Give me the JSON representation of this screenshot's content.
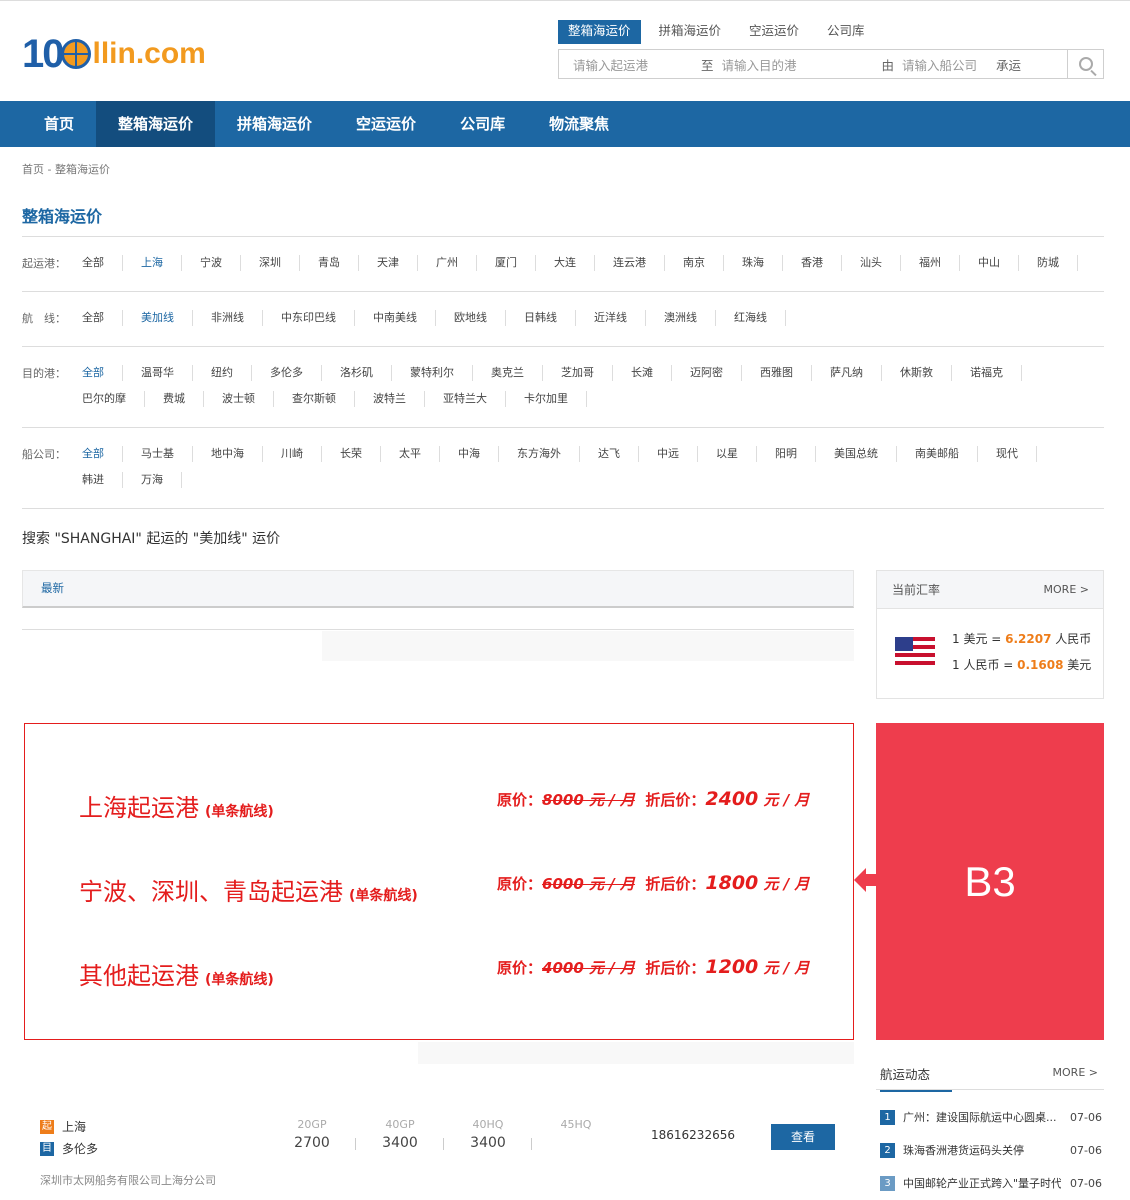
{
  "logo": {
    "num": "10",
    "rest": "llin.com"
  },
  "search": {
    "tabs": [
      "整箱海运价",
      "拼箱海运价",
      "空运运价",
      "公司库"
    ],
    "from_placeholder": "请输入起运港",
    "sep_to": "至",
    "to_placeholder": "请输入目的港",
    "sep_by": "由",
    "carrier_placeholder": "请输入船公司",
    "ship": "承运"
  },
  "nav": [
    "首页",
    "整箱海运价",
    "拼箱海运价",
    "空运运价",
    "公司库",
    "物流聚焦"
  ],
  "breadcrumb": "首页  -  整箱海运价",
  "page_title": "整箱海运价",
  "filters": {
    "origin": {
      "label": "起运港：",
      "options": [
        "全部",
        "上海",
        "宁波",
        "深圳",
        "青岛",
        "天津",
        "广州",
        "厦门",
        "大连",
        "连云港",
        "南京",
        "珠海",
        "香港",
        "汕头",
        "福州",
        "中山",
        "防城"
      ],
      "active": 1
    },
    "route": {
      "label": "航　线：",
      "options": [
        "全部",
        "美加线",
        "非洲线",
        "中东印巴线",
        "中南美线",
        "欧地线",
        "日韩线",
        "近洋线",
        "澳洲线",
        "红海线"
      ],
      "active": 1
    },
    "destination": {
      "label": "目的港：",
      "options": [
        "全部",
        "温哥华",
        "纽约",
        "多伦多",
        "洛杉矶",
        "蒙特利尔",
        "奥克兰",
        "芝加哥",
        "长滩",
        "迈阿密",
        "西雅图",
        "萨凡纳",
        "休斯敦",
        "诺福克",
        "巴尔的摩",
        "费城",
        "波士顿",
        "查尔斯顿",
        "波特兰",
        "亚特兰大",
        "卡尔加里"
      ],
      "active": 0
    },
    "carrier": {
      "label": "船公司：",
      "options": [
        "全部",
        "马士基",
        "地中海",
        "川崎",
        "长荣",
        "太平",
        "中海",
        "东方海外",
        "达飞",
        "中远",
        "以星",
        "阳明",
        "美国总统",
        "南美邮船",
        "现代",
        "韩进",
        "万海"
      ],
      "active": 0
    }
  },
  "search_result": "搜索 \"SHANGHAI\" 起运的 \"美加线\" 运价",
  "list_tab": "最新",
  "rate": {
    "title": "当前汇率",
    "more": "MORE >",
    "line1_pre": "1 美元 = ",
    "line1_val": "6.2207",
    "line1_post": " 人民币",
    "line2_pre": "1 人民币 = ",
    "line2_val": "0.1608",
    "line2_post": " 美元"
  },
  "ad": {
    "rows": [
      {
        "port": "上海起运港",
        "note": "(单条航线)",
        "orig_label": "原价：",
        "orig": "8000 元 / 月",
        "new_label": "折后价：",
        "new": "2400",
        "unit": " 元 / 月"
      },
      {
        "port": "宁波、深圳、青岛起运港",
        "note": "(单条航线)",
        "orig_label": "原价：",
        "orig": "6000 元 / 月",
        "new_label": "折后价：",
        "new": "1800",
        "unit": " 元 / 月"
      },
      {
        "port": "其他起运港",
        "note": "(单条航线)",
        "orig_label": "原价：",
        "orig": "4000 元 / 月",
        "new_label": "折后价：",
        "new": "1200",
        "unit": " 元 / 月"
      }
    ],
    "side_label": "B3"
  },
  "listing": {
    "from_tag": "起",
    "from": "上海",
    "to_tag": "目",
    "to": "多伦多",
    "containers": [
      {
        "type": "20GP",
        "price": "2700"
      },
      {
        "type": "40GP",
        "price": "3400"
      },
      {
        "type": "40HQ",
        "price": "3400"
      },
      {
        "type": "45HQ",
        "price": ""
      }
    ],
    "phone": "18616232656",
    "view": "查看",
    "company": "深圳市太网船务有限公司上海分公司"
  },
  "news": {
    "title": "航运动态",
    "more": "MORE >",
    "items": [
      {
        "idx": "1",
        "text": "广州：建设国际航运中心圆桌...",
        "date": "07-06"
      },
      {
        "idx": "2",
        "text": "珠海香洲港货运码头关停",
        "date": "07-06"
      },
      {
        "idx": "3",
        "text": "中国邮轮产业正式跨入\"量子时代\"",
        "date": "07-06"
      }
    ]
  },
  "colors": {
    "brand_blue": "#1d67a3",
    "accent_orange": "#ee7d1a",
    "ad_red": "#e41d1d",
    "b3_red": "#ee3d4d"
  }
}
